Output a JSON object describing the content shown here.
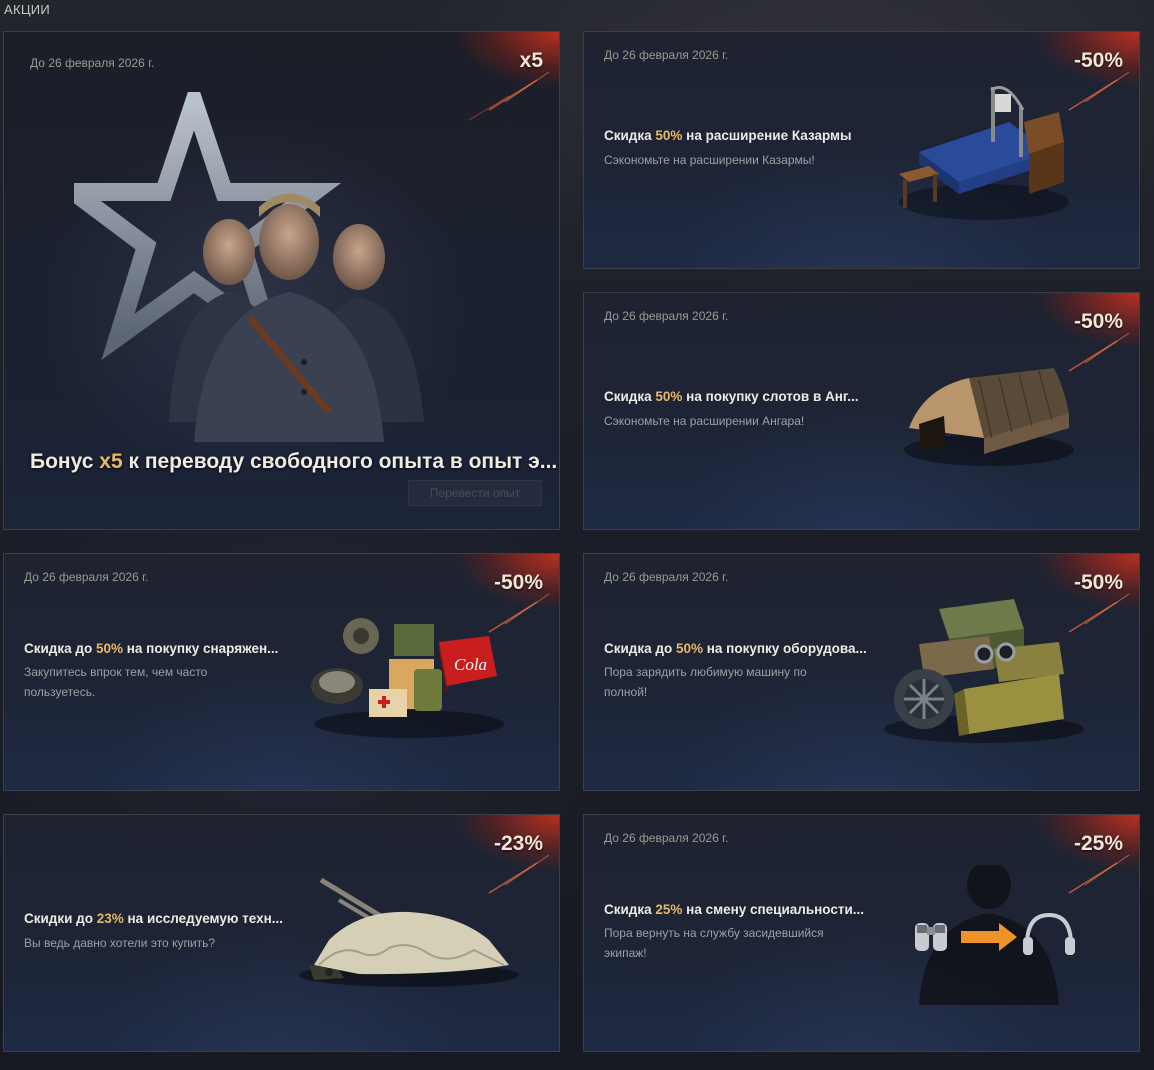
{
  "section": {
    "title": "АКЦИИ"
  },
  "big": {
    "date": "До 26 февраля 2026 г.",
    "badge": "x5",
    "title_pre": "Бонус ",
    "title_hl": "x5",
    "title_post": " к переводу свободного опыта в опыт э...",
    "cta": "Перевести опыт"
  },
  "cards": [
    {
      "date": "До 26 февраля 2026 г.",
      "badge": "-50%",
      "title_pre": "Скидка ",
      "title_hl": "50%",
      "title_post": " на расширение Казармы",
      "desc": "Сэкономьте на расширении Казармы!",
      "icon": "barracks-bed-icon"
    },
    {
      "date": "До 26 февраля 2026 г.",
      "badge": "-50%",
      "title_pre": "Скидка ",
      "title_hl": "50%",
      "title_post": " на покупку слотов в Анг...",
      "desc": "Сэкономьте на расширении Ангара!",
      "icon": "hangar-icon"
    },
    {
      "date": "До 26 февраля 2026 г.",
      "badge": "-50%",
      "title_pre": "Скидка до ",
      "title_hl": "50%",
      "title_post": " на покупку снаряжен...",
      "desc1": "Закупитесь впрок тем, чем часто",
      "desc2": "пользуетесь.",
      "icon": "consumables-icon",
      "cola": "Cola"
    },
    {
      "date": "До 26 февраля 2026 г.",
      "badge": "-50%",
      "title_pre": "Скидка до ",
      "title_hl": "50%",
      "title_post": " на покупку оборудова...",
      "desc1": "Пора зарядить любимую машину по",
      "desc2": "полной!",
      "icon": "equipment-crates-icon"
    },
    {
      "badge": "-23%",
      "title_pre": "Скидки до ",
      "title_hl": "23%",
      "title_post": " на исследуемую техн...",
      "desc": "Вы ведь давно хотели это купить?",
      "icon": "covered-tank-icon"
    },
    {
      "date": "До 26 февраля 2026 г.",
      "badge": "-25%",
      "title_pre": "Скидка ",
      "title_hl": "25%",
      "title_post": " на смену специальности...",
      "desc1": "Пора вернуть на службу засидевшийся",
      "desc2": "экипаж!",
      "icon": "crew-retrain-icon"
    }
  ],
  "colors": {
    "accent": "#e8b86a",
    "badge_glow": "#d2321e",
    "card_bg": "#1d2436"
  }
}
